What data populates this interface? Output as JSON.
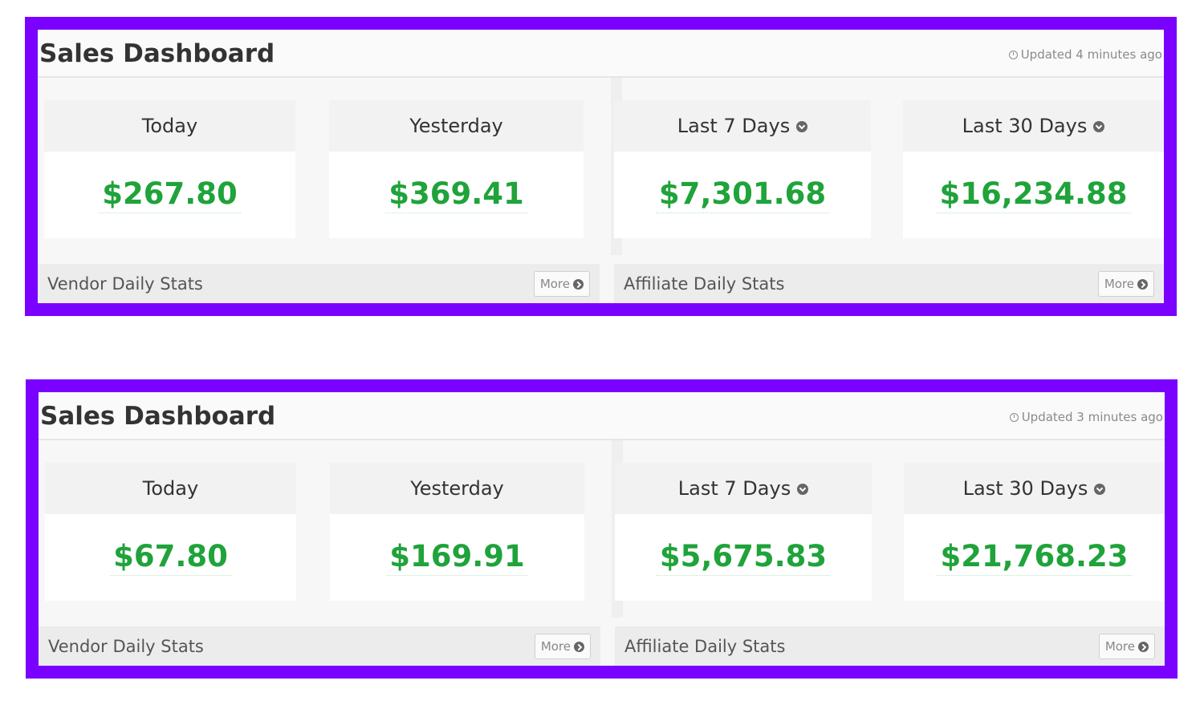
{
  "panels": [
    {
      "title": "Sales Dashboard",
      "updated": "Updated 4 minutes ago",
      "cards": [
        {
          "label": "Today",
          "value": "$267.80"
        },
        {
          "label": "Yesterday",
          "value": "$369.41"
        },
        {
          "label": "Last 7 Days",
          "value": "$7,301.68"
        },
        {
          "label": "Last 30 Days",
          "value": "$16,234.88"
        }
      ],
      "footer": {
        "vendor_label": "Vendor Daily Stats",
        "affiliate_label": "Affiliate Daily Stats",
        "more_label": "More"
      }
    },
    {
      "title": "Sales Dashboard",
      "updated": "Updated 3 minutes ago",
      "cards": [
        {
          "label": "Today",
          "value": "$67.80"
        },
        {
          "label": "Yesterday",
          "value": "$169.91"
        },
        {
          "label": "Last 7 Days",
          "value": "$5,675.83"
        },
        {
          "label": "Last 30 Days",
          "value": "$21,768.23"
        }
      ],
      "footer": {
        "vendor_label": "Vendor Daily Stats",
        "affiliate_label": "Affiliate Daily Stats",
        "more_label": "More"
      }
    }
  ],
  "colors": {
    "frame": "#7a00ff",
    "amount": "#1fa33a"
  },
  "icons": {
    "updated": "clock-icon",
    "range_dropdown": "chevron-down-circle-icon",
    "more": "chevron-right-circle-icon"
  }
}
